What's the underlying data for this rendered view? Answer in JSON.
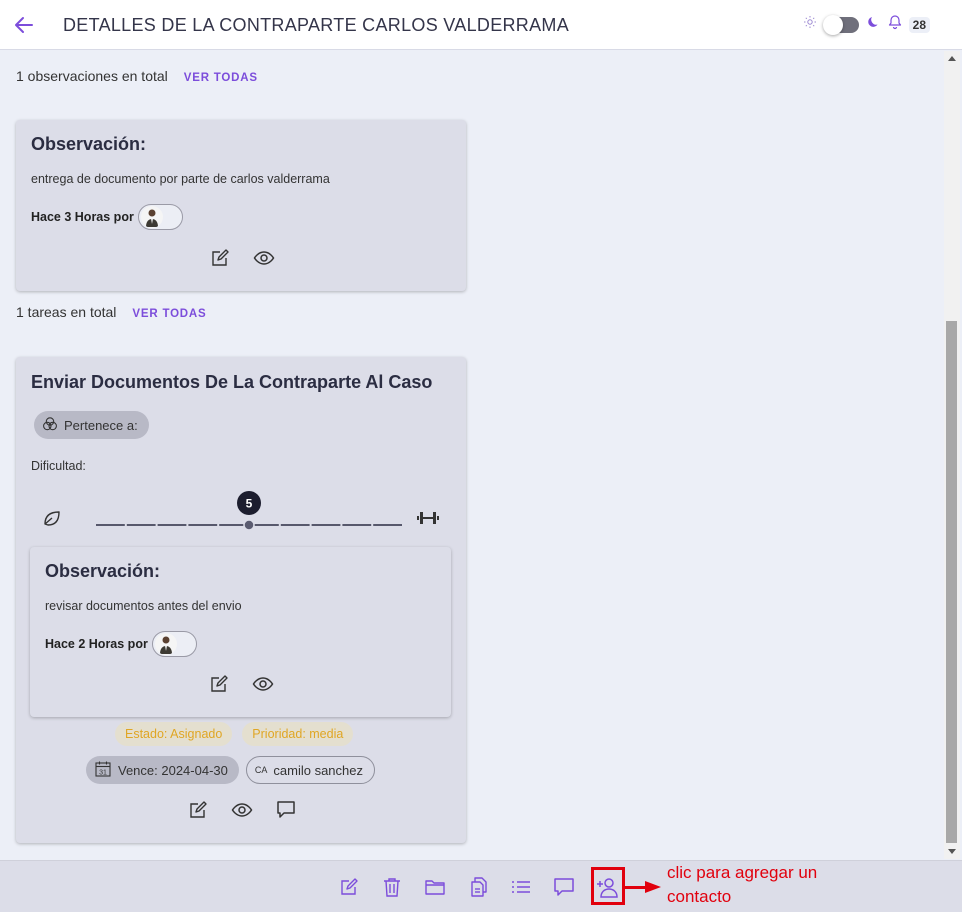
{
  "header": {
    "title": "DETALLES DE LA CONTRAPARTE CARLOS VALDERRAMA",
    "notifications_count": "28"
  },
  "observations_section": {
    "total_text": "1 observaciones en total",
    "view_all": "VER TODAS",
    "card": {
      "title": "Observación:",
      "text": "entrega de documento por parte de carlos valderrama",
      "meta": "Hace 3 Horas por"
    }
  },
  "tasks_section": {
    "total_text": "1 tareas en total",
    "view_all": "VER TODAS",
    "task": {
      "title": "Enviar Documentos De La Contraparte Al Caso",
      "belongs_chip": "Pertenece a:",
      "difficulty_label": "Dificultad:",
      "difficulty_value": 5,
      "difficulty_value_label": "5",
      "difficulty_max": 10,
      "observation": {
        "title": "Observación:",
        "text": "revisar documentos antes del envio",
        "meta": "Hace 2 Horas por"
      },
      "status": "Estado: Asignado",
      "priority": "Prioridad: media",
      "due": "Vence: 2024-04-30",
      "calendar_day": "31",
      "assignee_initials": "CA",
      "assignee": "camilo sanchez"
    }
  },
  "bottom_toolbar": {
    "icons": [
      "edit-icon",
      "trash-icon",
      "folder-icon",
      "copy-icon",
      "list-icon",
      "comment-icon",
      "add-contact-icon"
    ]
  },
  "annotation": {
    "text": "clic para agregar un contacto"
  },
  "colors": {
    "accent": "#7c4ddb",
    "annotation_red": "#e1000d",
    "status_yellow": "#e0a624"
  }
}
